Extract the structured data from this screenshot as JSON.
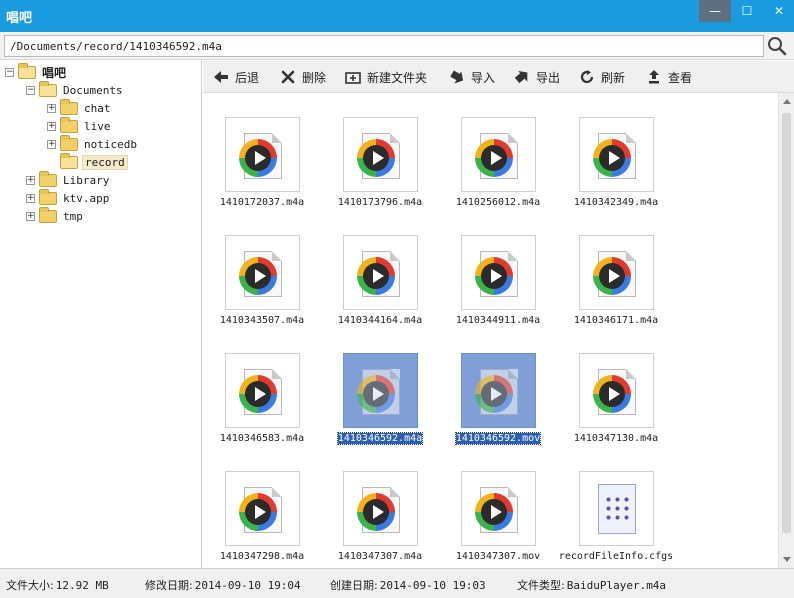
{
  "window": {
    "title": "唱吧",
    "minimize": "—",
    "maximize": "☐",
    "close": "✕"
  },
  "address": {
    "path": "/Documents/record/1410346592.m4a"
  },
  "tree": [
    {
      "label": "唱吧",
      "expander": "−",
      "bold": true,
      "depth": 0
    },
    {
      "label": "Documents",
      "expander": "−",
      "depth": 1
    },
    {
      "label": "chat",
      "expander": "+",
      "depth": 2
    },
    {
      "label": "live",
      "expander": "+",
      "depth": 2
    },
    {
      "label": "noticedb",
      "expander": "+",
      "depth": 2
    },
    {
      "label": "record",
      "expander": "",
      "depth": 2,
      "selected": true
    },
    {
      "label": "Library",
      "expander": "+",
      "depth": 1
    },
    {
      "label": "ktv.app",
      "expander": "+",
      "depth": 1
    },
    {
      "label": "tmp",
      "expander": "+",
      "depth": 1
    }
  ],
  "toolbar": {
    "back": "后退",
    "delete": "删除",
    "new_folder": "新建文件夹",
    "import": "导入",
    "export": "导出",
    "refresh": "刷新",
    "view": "查看"
  },
  "files": [
    {
      "name": "1410172037.m4a",
      "type": "media"
    },
    {
      "name": "1410173796.m4a",
      "type": "media"
    },
    {
      "name": "1410256012.m4a",
      "type": "media"
    },
    {
      "name": "1410342349.m4a",
      "type": "media"
    },
    {
      "name": "1410343507.m4a",
      "type": "media"
    },
    {
      "name": "1410344164.m4a",
      "type": "media"
    },
    {
      "name": "1410344911.m4a",
      "type": "media"
    },
    {
      "name": "1410346171.m4a",
      "type": "media"
    },
    {
      "name": "1410346583.m4a",
      "type": "media"
    },
    {
      "name": "1410346592.m4a",
      "type": "media",
      "selected": true
    },
    {
      "name": "1410346592.mov",
      "type": "media",
      "selected": true
    },
    {
      "name": "1410347130.m4a",
      "type": "media"
    },
    {
      "name": "1410347298.m4a",
      "type": "media"
    },
    {
      "name": "1410347307.m4a",
      "type": "media"
    },
    {
      "name": "1410347307.mov",
      "type": "media"
    },
    {
      "name": "recordFileInfo.cfgs",
      "type": "config"
    }
  ],
  "status": {
    "size_label": "文件大小:",
    "size_value": "12.92 MB",
    "modified_label": "修改日期:",
    "modified_value": "2014-09-10 19:04",
    "created_label": "创建日期:",
    "created_value": "2014-09-10 19:03",
    "type_label": "文件类型:",
    "type_value": "BaiduPlayer.m4a"
  }
}
